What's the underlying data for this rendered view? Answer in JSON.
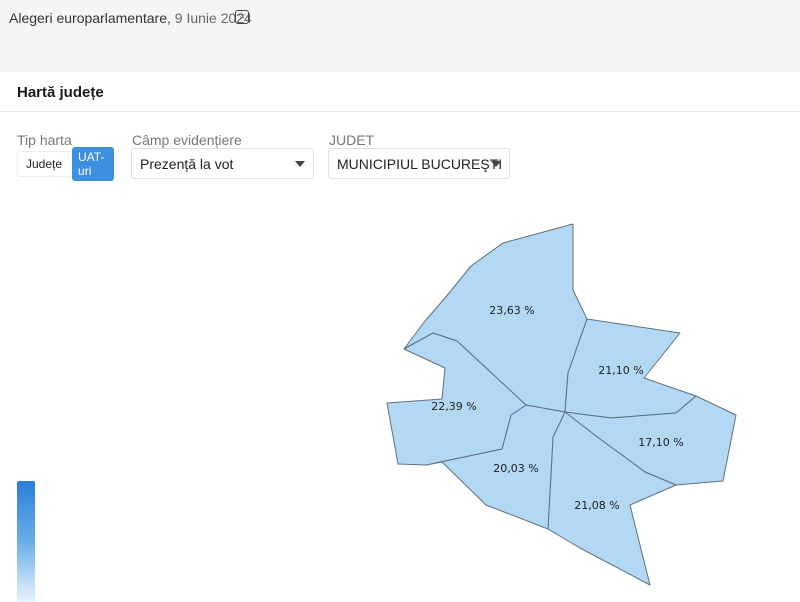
{
  "header": {
    "breadcrumb": "Alegeri europarlamentare,",
    "date": "9 Iunie 2024",
    "star_icon": "star-icon"
  },
  "section": {
    "title": "Hartă județe"
  },
  "controls": {
    "map_type": {
      "label": "Tip harta",
      "options": [
        "Județe",
        "UAT-uri"
      ],
      "active": "UAT-uri"
    },
    "highlight_field": {
      "label": "Câmp evidențiere",
      "value": "Prezență la vot"
    },
    "county": {
      "label": "JUDET",
      "value": "MUNICIPIUL BUCUREŞTI"
    }
  },
  "map": {
    "region": "MUNICIPIUL BUCUREŞTI",
    "metric": "Prezență la vot",
    "fill_color": "#b3d8f4",
    "sectors": [
      {
        "value": "23,63 %"
      },
      {
        "value": "21,10 %"
      },
      {
        "value": "17,10 %"
      },
      {
        "value": "21,08 %"
      },
      {
        "value": "20,03 %"
      },
      {
        "value": "22,39 %"
      }
    ]
  },
  "legend": {
    "gradient_colors": [
      "#2b7fd8",
      "#e8f3fc"
    ]
  }
}
